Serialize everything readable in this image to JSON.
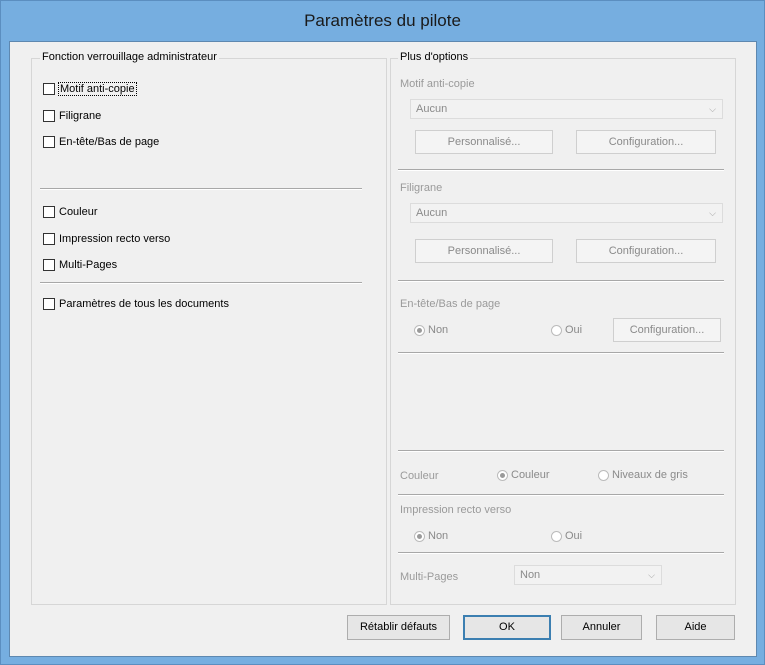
{
  "window": {
    "title": "Paramètres du pilote"
  },
  "left": {
    "legend": "Fonction verrouillage administrateur",
    "group1": [
      "Motif anti-copie",
      "Filigrane",
      "En-tête/Bas de page"
    ],
    "group2": [
      "Couleur",
      "Impression recto verso",
      "Multi-Pages"
    ],
    "group3": [
      "Paramètres de tous les documents"
    ]
  },
  "right": {
    "legend": "Plus d'options",
    "anticopy": {
      "label": "Motif anti-copie",
      "value": "Aucun",
      "custom_btn": "Personnalisé...",
      "config_btn": "Configuration..."
    },
    "watermark": {
      "label": "Filigrane",
      "value": "Aucun",
      "custom_btn": "Personnalisé...",
      "config_btn": "Configuration..."
    },
    "header": {
      "label": "En-tête/Bas de page",
      "opt_no": "Non",
      "opt_yes": "Oui",
      "config_btn": "Configuration..."
    },
    "color": {
      "label": "Couleur",
      "opt_color": "Couleur",
      "opt_gray": "Niveaux de gris"
    },
    "duplex": {
      "label": "Impression recto verso",
      "opt_no": "Non",
      "opt_yes": "Oui"
    },
    "multipage": {
      "label": "Multi-Pages",
      "value": "Non"
    }
  },
  "buttons": {
    "reset": "Rétablir défauts",
    "ok": "OK",
    "cancel": "Annuler",
    "help": "Aide"
  }
}
